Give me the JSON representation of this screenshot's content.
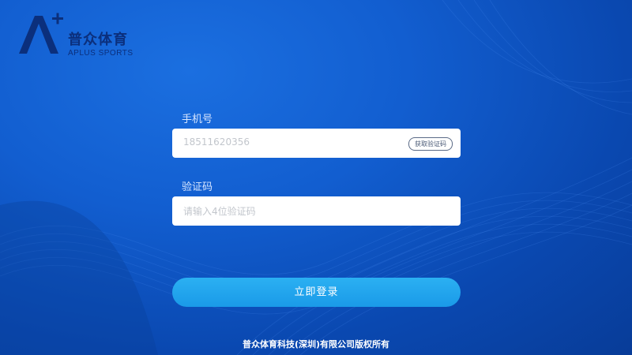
{
  "brand": {
    "name_cn": "普众体育",
    "name_en": "APLUS SPORTS",
    "logo_icon": "a-plus-logo-icon"
  },
  "form": {
    "phone_label": "手机号",
    "phone_value": "18511620356",
    "get_code_label": "获取验证码",
    "code_label": "验证码",
    "code_placeholder": "请输入4位验证码"
  },
  "login_button": {
    "label": "立即登录"
  },
  "footer": {
    "copyright": "普众体育科技(深圳)有限公司版权所有"
  },
  "colors": {
    "background": "#125ed0",
    "logo": "#0b2f7c",
    "button": "#1fa3ec",
    "input_bg": "#ffffff"
  }
}
